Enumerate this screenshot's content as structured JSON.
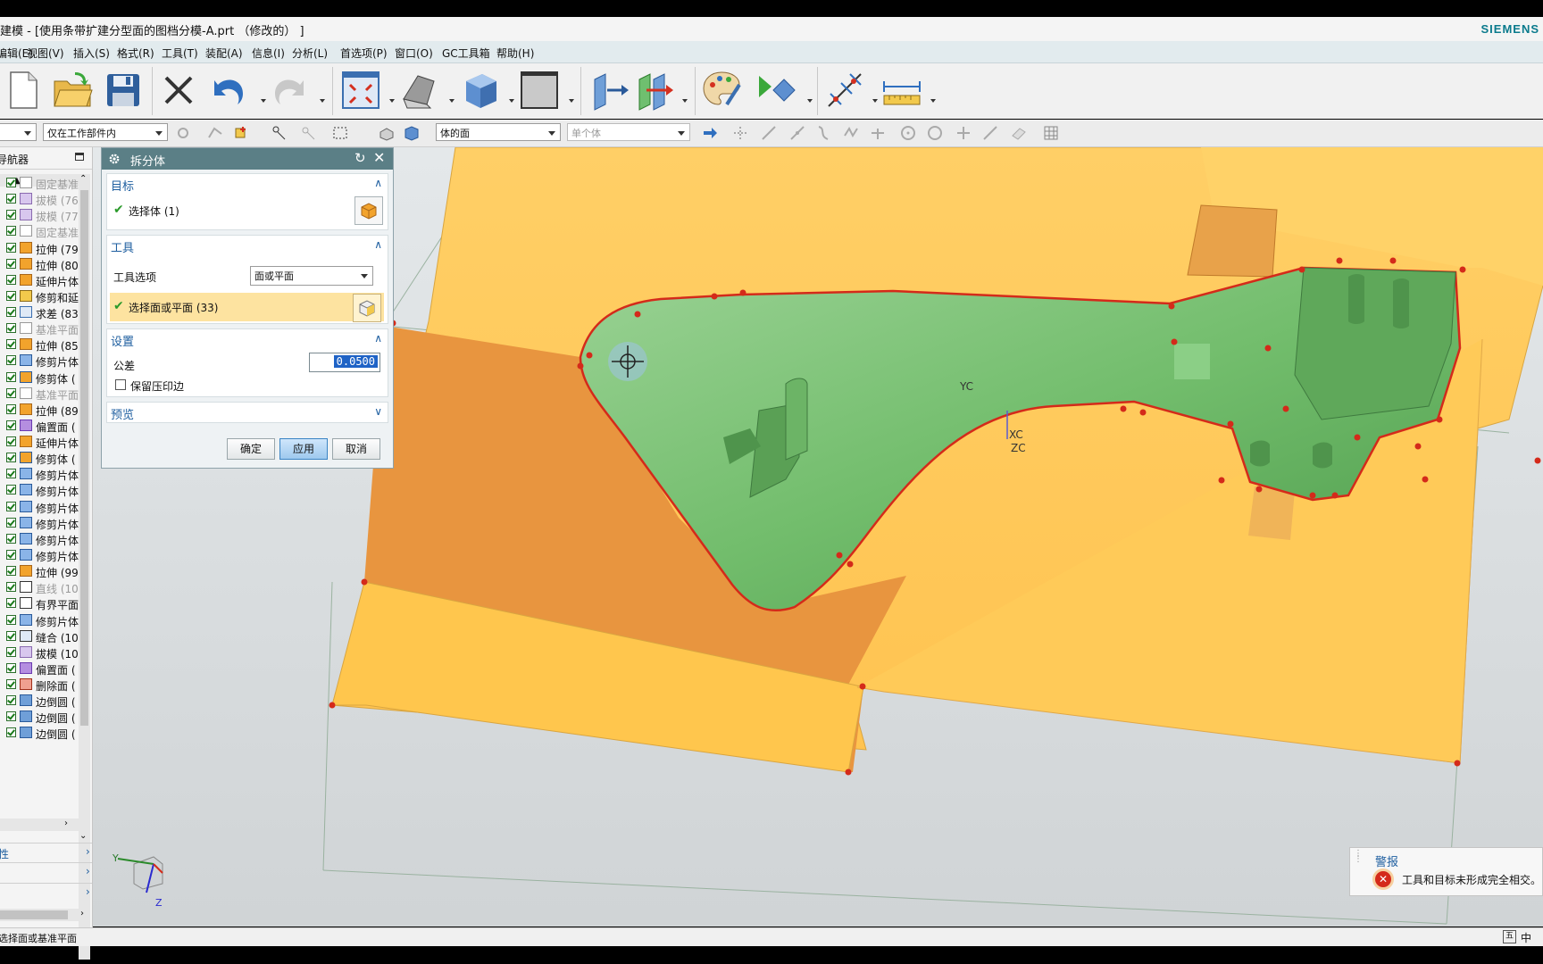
{
  "window": {
    "title": "建模 - [使用条带扩建分型面的图档分模-A.prt （修改的） ]",
    "brand": "SIEMENS"
  },
  "menu": [
    "编辑(E)",
    "视图(V)",
    "插入(S)",
    "格式(R)",
    "工具(T)",
    "装配(A)",
    "信息(I)",
    "分析(L)",
    "首选项(P)",
    "窗口(O)",
    "GC工具箱",
    "帮助(H)"
  ],
  "filterbar": {
    "scope": "仅在工作部件内",
    "face_rule": "体的面",
    "body_rule": "单个体"
  },
  "navigator": {
    "title": "导航器",
    "items": [
      {
        "label": "固定基准",
        "icon": "datum-plane-icon",
        "dim": true
      },
      {
        "label": "拔模 (76",
        "icon": "draft-icon",
        "dim": true
      },
      {
        "label": "拔模 (77",
        "icon": "draft-icon",
        "dim": true
      },
      {
        "label": "固定基准",
        "icon": "datum-plane-icon",
        "dim": true
      },
      {
        "label": "拉伸 (79",
        "icon": "extrude-icon",
        "dim": false
      },
      {
        "label": "拉伸 (80",
        "icon": "extrude-icon",
        "dim": false
      },
      {
        "label": "延伸片体",
        "icon": "extend-sheet-icon",
        "dim": false
      },
      {
        "label": "修剪和延",
        "icon": "trim-extend-icon",
        "dim": false
      },
      {
        "label": "求差 (83",
        "icon": "subtract-icon",
        "dim": false
      },
      {
        "label": "基准平面",
        "icon": "datum-plane-icon",
        "dim": true
      },
      {
        "label": "拉伸 (85",
        "icon": "extrude-icon",
        "dim": false
      },
      {
        "label": "修剪片体",
        "icon": "trim-sheet-icon",
        "dim": false
      },
      {
        "label": "修剪体 (",
        "icon": "trim-body-icon",
        "dim": false
      },
      {
        "label": "基准平面",
        "icon": "datum-plane-icon",
        "dim": true
      },
      {
        "label": "拉伸 (89",
        "icon": "extrude-icon",
        "dim": false
      },
      {
        "label": "偏置面 (",
        "icon": "offset-face-icon",
        "dim": false
      },
      {
        "label": "延伸片体",
        "icon": "extend-sheet-icon",
        "dim": false
      },
      {
        "label": "修剪体 (",
        "icon": "trim-body-icon",
        "dim": false
      },
      {
        "label": "修剪片体",
        "icon": "trim-sheet-icon",
        "dim": false
      },
      {
        "label": "修剪片体",
        "icon": "trim-sheet-icon",
        "dim": false
      },
      {
        "label": "修剪片体",
        "icon": "trim-sheet-icon",
        "dim": false
      },
      {
        "label": "修剪片体",
        "icon": "trim-sheet-icon",
        "dim": false
      },
      {
        "label": "修剪片体",
        "icon": "trim-sheet-icon",
        "dim": false
      },
      {
        "label": "修剪片体",
        "icon": "trim-sheet-icon",
        "dim": false
      },
      {
        "label": "拉伸 (99",
        "icon": "extrude-icon",
        "dim": false
      },
      {
        "label": "直线 (10",
        "icon": "line-icon",
        "dim": true
      },
      {
        "label": "有界平面",
        "icon": "bounded-plane-icon",
        "dim": false
      },
      {
        "label": "修剪片体",
        "icon": "trim-sheet-icon",
        "dim": false
      },
      {
        "label": "缝合 (10",
        "icon": "sew-icon",
        "dim": false
      },
      {
        "label": "拔模 (10",
        "icon": "draft-icon",
        "dim": false
      },
      {
        "label": "偏置面 (",
        "icon": "offset-face-icon",
        "dim": false
      },
      {
        "label": "删除面 (",
        "icon": "delete-face-icon",
        "dim": false
      },
      {
        "label": "边倒圆 (",
        "icon": "edge-blend-icon",
        "dim": false
      },
      {
        "label": "边倒圆 (",
        "icon": "edge-blend-icon",
        "dim": false
      },
      {
        "label": "边倒圆 (",
        "icon": "edge-blend-icon",
        "dim": false
      }
    ],
    "panel1": "性",
    "panel2": "",
    "panel3": ""
  },
  "dialog": {
    "title": "拆分体",
    "target": {
      "header": "目标",
      "select_label": "选择体 (1)"
    },
    "tool": {
      "header": "工具",
      "option_label": "工具选项",
      "option_value": "面或平面",
      "select_label": "选择面或平面 (33)"
    },
    "settings": {
      "header": "设置",
      "tolerance_label": "公差",
      "tolerance_value": "0.0500",
      "keep_imprint_label": "保留压印边"
    },
    "preview": {
      "header": "预览"
    },
    "buttons": {
      "ok": "确定",
      "apply": "应用",
      "cancel": "取消"
    }
  },
  "viewport": {
    "labels": {
      "yc": "YC",
      "xc": "XC",
      "zc": "ZC"
    },
    "triad": {
      "y": "Y",
      "z": "Z"
    }
  },
  "alert": {
    "title": "警报",
    "message": "工具和目标未形成完全相交。"
  },
  "status": {
    "prompt": "选择面或基准平面",
    "ime": "中"
  },
  "colors": {
    "parting_face": "#ffc85a",
    "core": "#7dc47a",
    "edge_highlight": "#d42a1a",
    "dialog_title": "#5b7f86",
    "accent_blue": "#1f5fa0"
  }
}
